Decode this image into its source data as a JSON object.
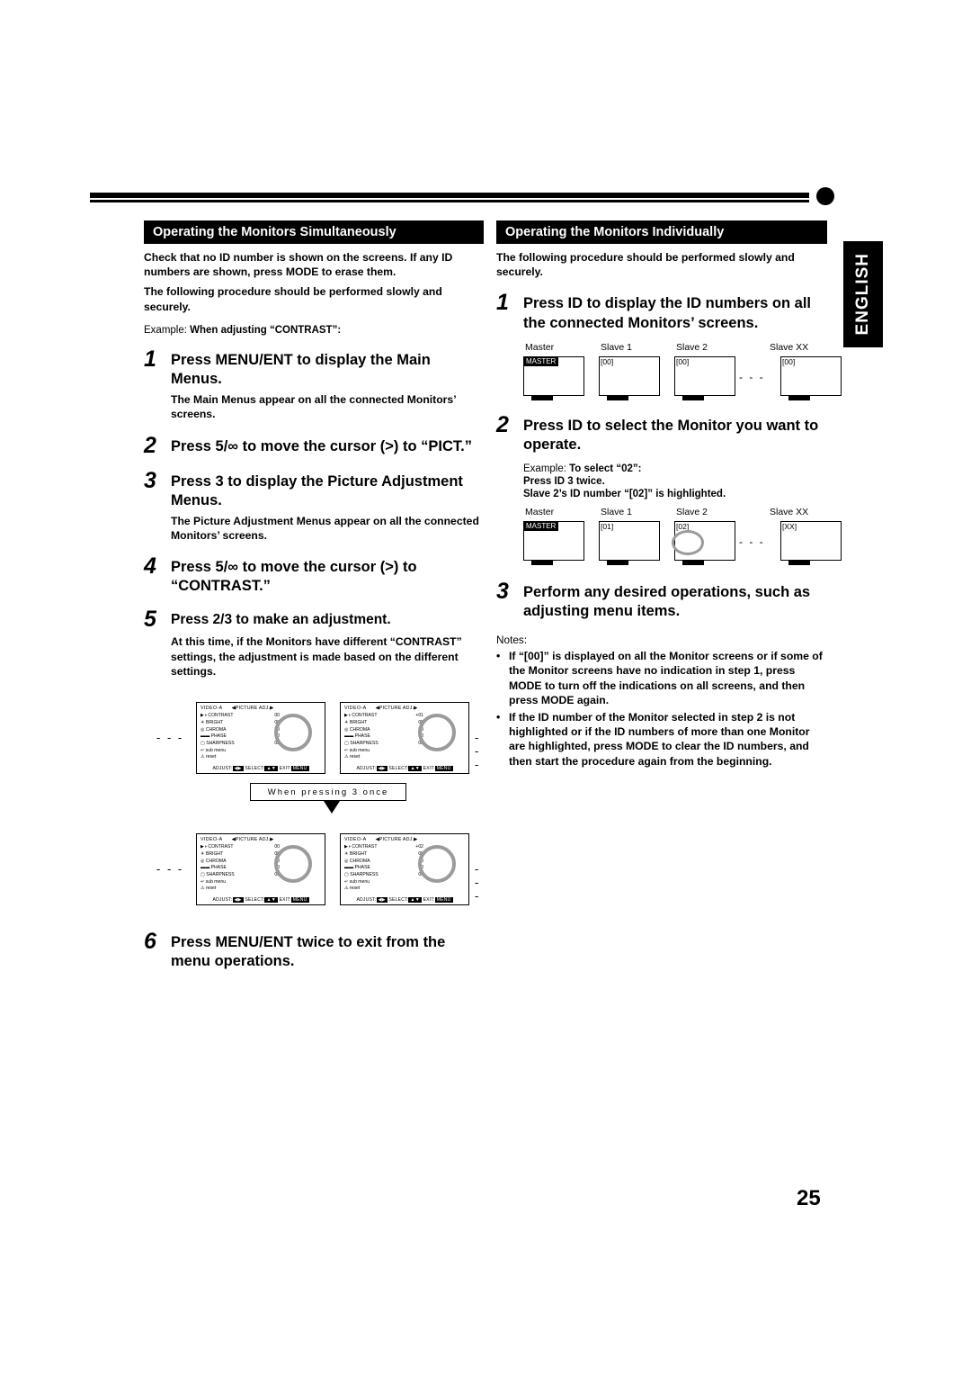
{
  "page": {
    "number": "25",
    "side_tab": "ENGLISH"
  },
  "left_column": {
    "header": "Operating the Monitors Simultaneously",
    "intro1": "Check that no ID number is shown on the screens. If any ID numbers are shown, press MODE to erase them.",
    "intro2": "The following procedure should be performed slowly and securely.",
    "example_label": "Example:",
    "example_text": "When adjusting “CONTRAST”:",
    "steps": [
      {
        "num": "1",
        "text": "Press MENU/ENT to display the Main Menus.",
        "sub": "The Main Menus appear on all the connected Monitors’ screens."
      },
      {
        "num": "2",
        "text": "Press 5/∞ to move the cursor (>) to “PICT.”",
        "sub": ""
      },
      {
        "num": "3",
        "text": "Press 3 to display the Picture Adjustment Menus.",
        "sub": "The Picture Adjustment Menus appear on all the connected Monitors’ screens."
      },
      {
        "num": "4",
        "text": "Press 5/∞ to move the cursor (>) to “CONTRAST.”",
        "sub": ""
      },
      {
        "num": "5",
        "text": "Press 2/3 to make an adjustment.",
        "sub": "At this time, if the Monitors have different “CONTRAST” settings, the adjustment is made based on the different settings."
      },
      {
        "num": "6",
        "text": "Press MENU/ENT twice to exit from the menu operations.",
        "sub": ""
      }
    ],
    "when_pressing": "When pressing 3 once",
    "osd_before": [
      {
        "video": "VIDEO-A",
        "menu": "◀PICTURE ADJ.▶",
        "rows": [
          {
            "label": "▶◑ CONTRAST",
            "value": "00"
          },
          {
            "label": "☀ BRIGHT",
            "value": "00"
          },
          {
            "label": "◎ CHROMA",
            "value": "00"
          },
          {
            "label": "▬▬ PHASE",
            "value": "00"
          },
          {
            "label": "▢ SHARPNESS",
            "value": "00"
          },
          {
            "label": "↵ sub menu",
            "value": ""
          },
          {
            "label": "⚠ reset",
            "value": ""
          }
        ],
        "footer_adjust": "ADJUST:",
        "footer_adjust_key": "◀▶",
        "footer_select": "SELECT:",
        "footer_select_key": "▲▼",
        "footer_exit": "EXIT:",
        "footer_exit_key": "MENU"
      },
      {
        "video": "VIDEO-A",
        "menu": "◀PICTURE ADJ.▶",
        "rows": [
          {
            "label": "▶◑ CONTRAST",
            "value": "+01"
          },
          {
            "label": "☀ BRIGHT",
            "value": "00"
          },
          {
            "label": "◎ CHROMA",
            "value": "00"
          },
          {
            "label": "▬▬ PHASE",
            "value": "00"
          },
          {
            "label": "▢ SHARPNESS",
            "value": "00"
          },
          {
            "label": "↵ sub menu",
            "value": ""
          },
          {
            "label": "⚠ reset",
            "value": ""
          }
        ]
      }
    ],
    "osd_after": [
      {
        "video": "VIDEO-A",
        "menu": "◀PICTURE ADJ.▶",
        "rows": [
          {
            "label": "▶◑ CONTRAST",
            "value": "00"
          },
          {
            "label": "☀ BRIGHT",
            "value": "00"
          },
          {
            "label": "◎ CHROMA",
            "value": "00"
          },
          {
            "label": "▬▬ PHASE",
            "value": "00"
          },
          {
            "label": "▢ SHARPNESS",
            "value": "00"
          },
          {
            "label": "↵ sub menu",
            "value": ""
          },
          {
            "label": "⚠ reset",
            "value": ""
          }
        ]
      },
      {
        "video": "VIDEO-A",
        "menu": "◀PICTURE ADJ.▶",
        "rows": [
          {
            "label": "▶◑ CONTRAST",
            "value": "+02"
          },
          {
            "label": "☀ BRIGHT",
            "value": "00"
          },
          {
            "label": "◎ CHROMA",
            "value": "00"
          },
          {
            "label": "▬▬ PHASE",
            "value": "00"
          },
          {
            "label": "▢ SHARPNESS",
            "value": "00"
          },
          {
            "label": "↵ sub menu",
            "value": ""
          },
          {
            "label": "⚠ reset",
            "value": ""
          }
        ]
      }
    ]
  },
  "right_column": {
    "header": "Operating the Monitors Individually",
    "intro": "The following procedure should be performed slowly and securely.",
    "steps": [
      {
        "num": "1",
        "text": "Press ID to display the ID numbers on all the connected Monitors’ screens."
      },
      {
        "num": "2",
        "text": "Press ID to select the Monitor you want to operate."
      },
      {
        "num": "3",
        "text": "Perform any desired operations, such as adjusting menu items."
      }
    ],
    "example_label": "Example:",
    "example_bold": "To select “02”:",
    "example_line2": "Press ID 3 twice.",
    "example_line3": "Slave 2’s ID number “[02]” is highlighted.",
    "diagram1": {
      "labels": [
        "Master",
        "Slave 1",
        "Slave 2",
        "Slave XX"
      ],
      "tags": [
        "MASTER",
        "[00]",
        "[00]",
        "[00]"
      ]
    },
    "diagram2": {
      "labels": [
        "Master",
        "Slave 1",
        "Slave 2",
        "Slave XX"
      ],
      "tags": [
        "MASTER",
        "[01]",
        "[02]",
        "[XX]"
      ]
    },
    "notes_title": "Notes:",
    "notes": [
      {
        "bullet": "•",
        "text": "If “[00]” is displayed on all the Monitor screens or if some of the Monitor screens have no indication in step 1, press MODE to turn off the indications on all screens, and then press MODE again."
      },
      {
        "bullet": "•",
        "text": "If the ID number of the Monitor selected in step 2 is not highlighted or if the ID numbers of more than one Monitor are highlighted, press MODE to clear the ID numbers, and then start the procedure again from the beginning."
      }
    ]
  }
}
